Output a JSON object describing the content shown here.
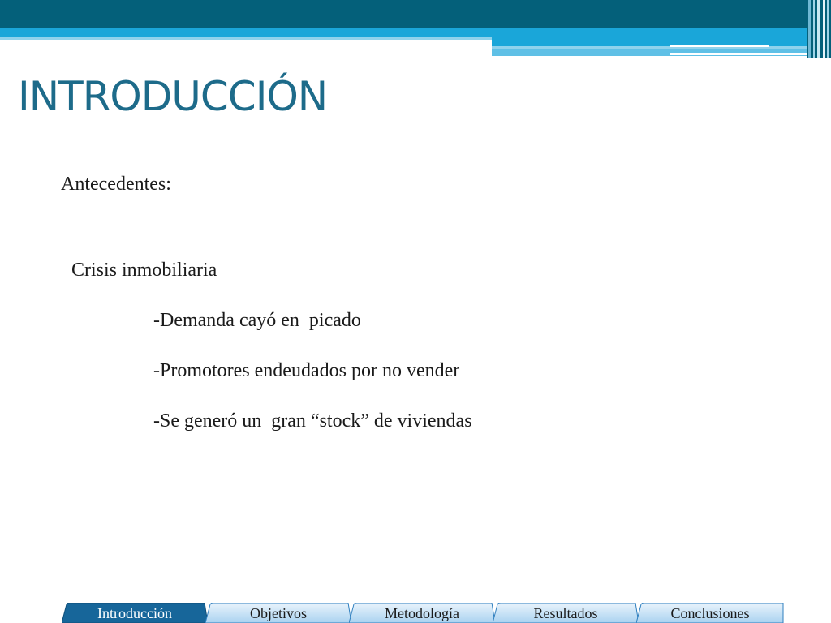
{
  "slide": {
    "title": "INTRODUCCIÓN",
    "subtitle": "Antecedentes:",
    "topic": "Crisis inmobiliaria",
    "bullets": [
      "-Demanda cayó en  picado",
      "-Promotores endeudados por no vender",
      "-Se generó un  gran “stock” de viviendas"
    ]
  },
  "nav": {
    "tabs": [
      {
        "label": "Introducción",
        "active": true
      },
      {
        "label": "Objetivos",
        "active": false
      },
      {
        "label": "Metodología",
        "active": false
      },
      {
        "label": "Resultados",
        "active": false
      },
      {
        "label": "Conclusiones",
        "active": false
      }
    ]
  },
  "colors": {
    "header_dark": "#04607a",
    "header_bright": "#1aa6d9",
    "header_light": "#8fd2ec",
    "title": "#1d6b8a",
    "tab_active": "#17669a",
    "tab_inactive_top": "#eaf4fc",
    "tab_inactive_bottom": "#a9d2f0",
    "tab_border": "#2f7fbf"
  }
}
